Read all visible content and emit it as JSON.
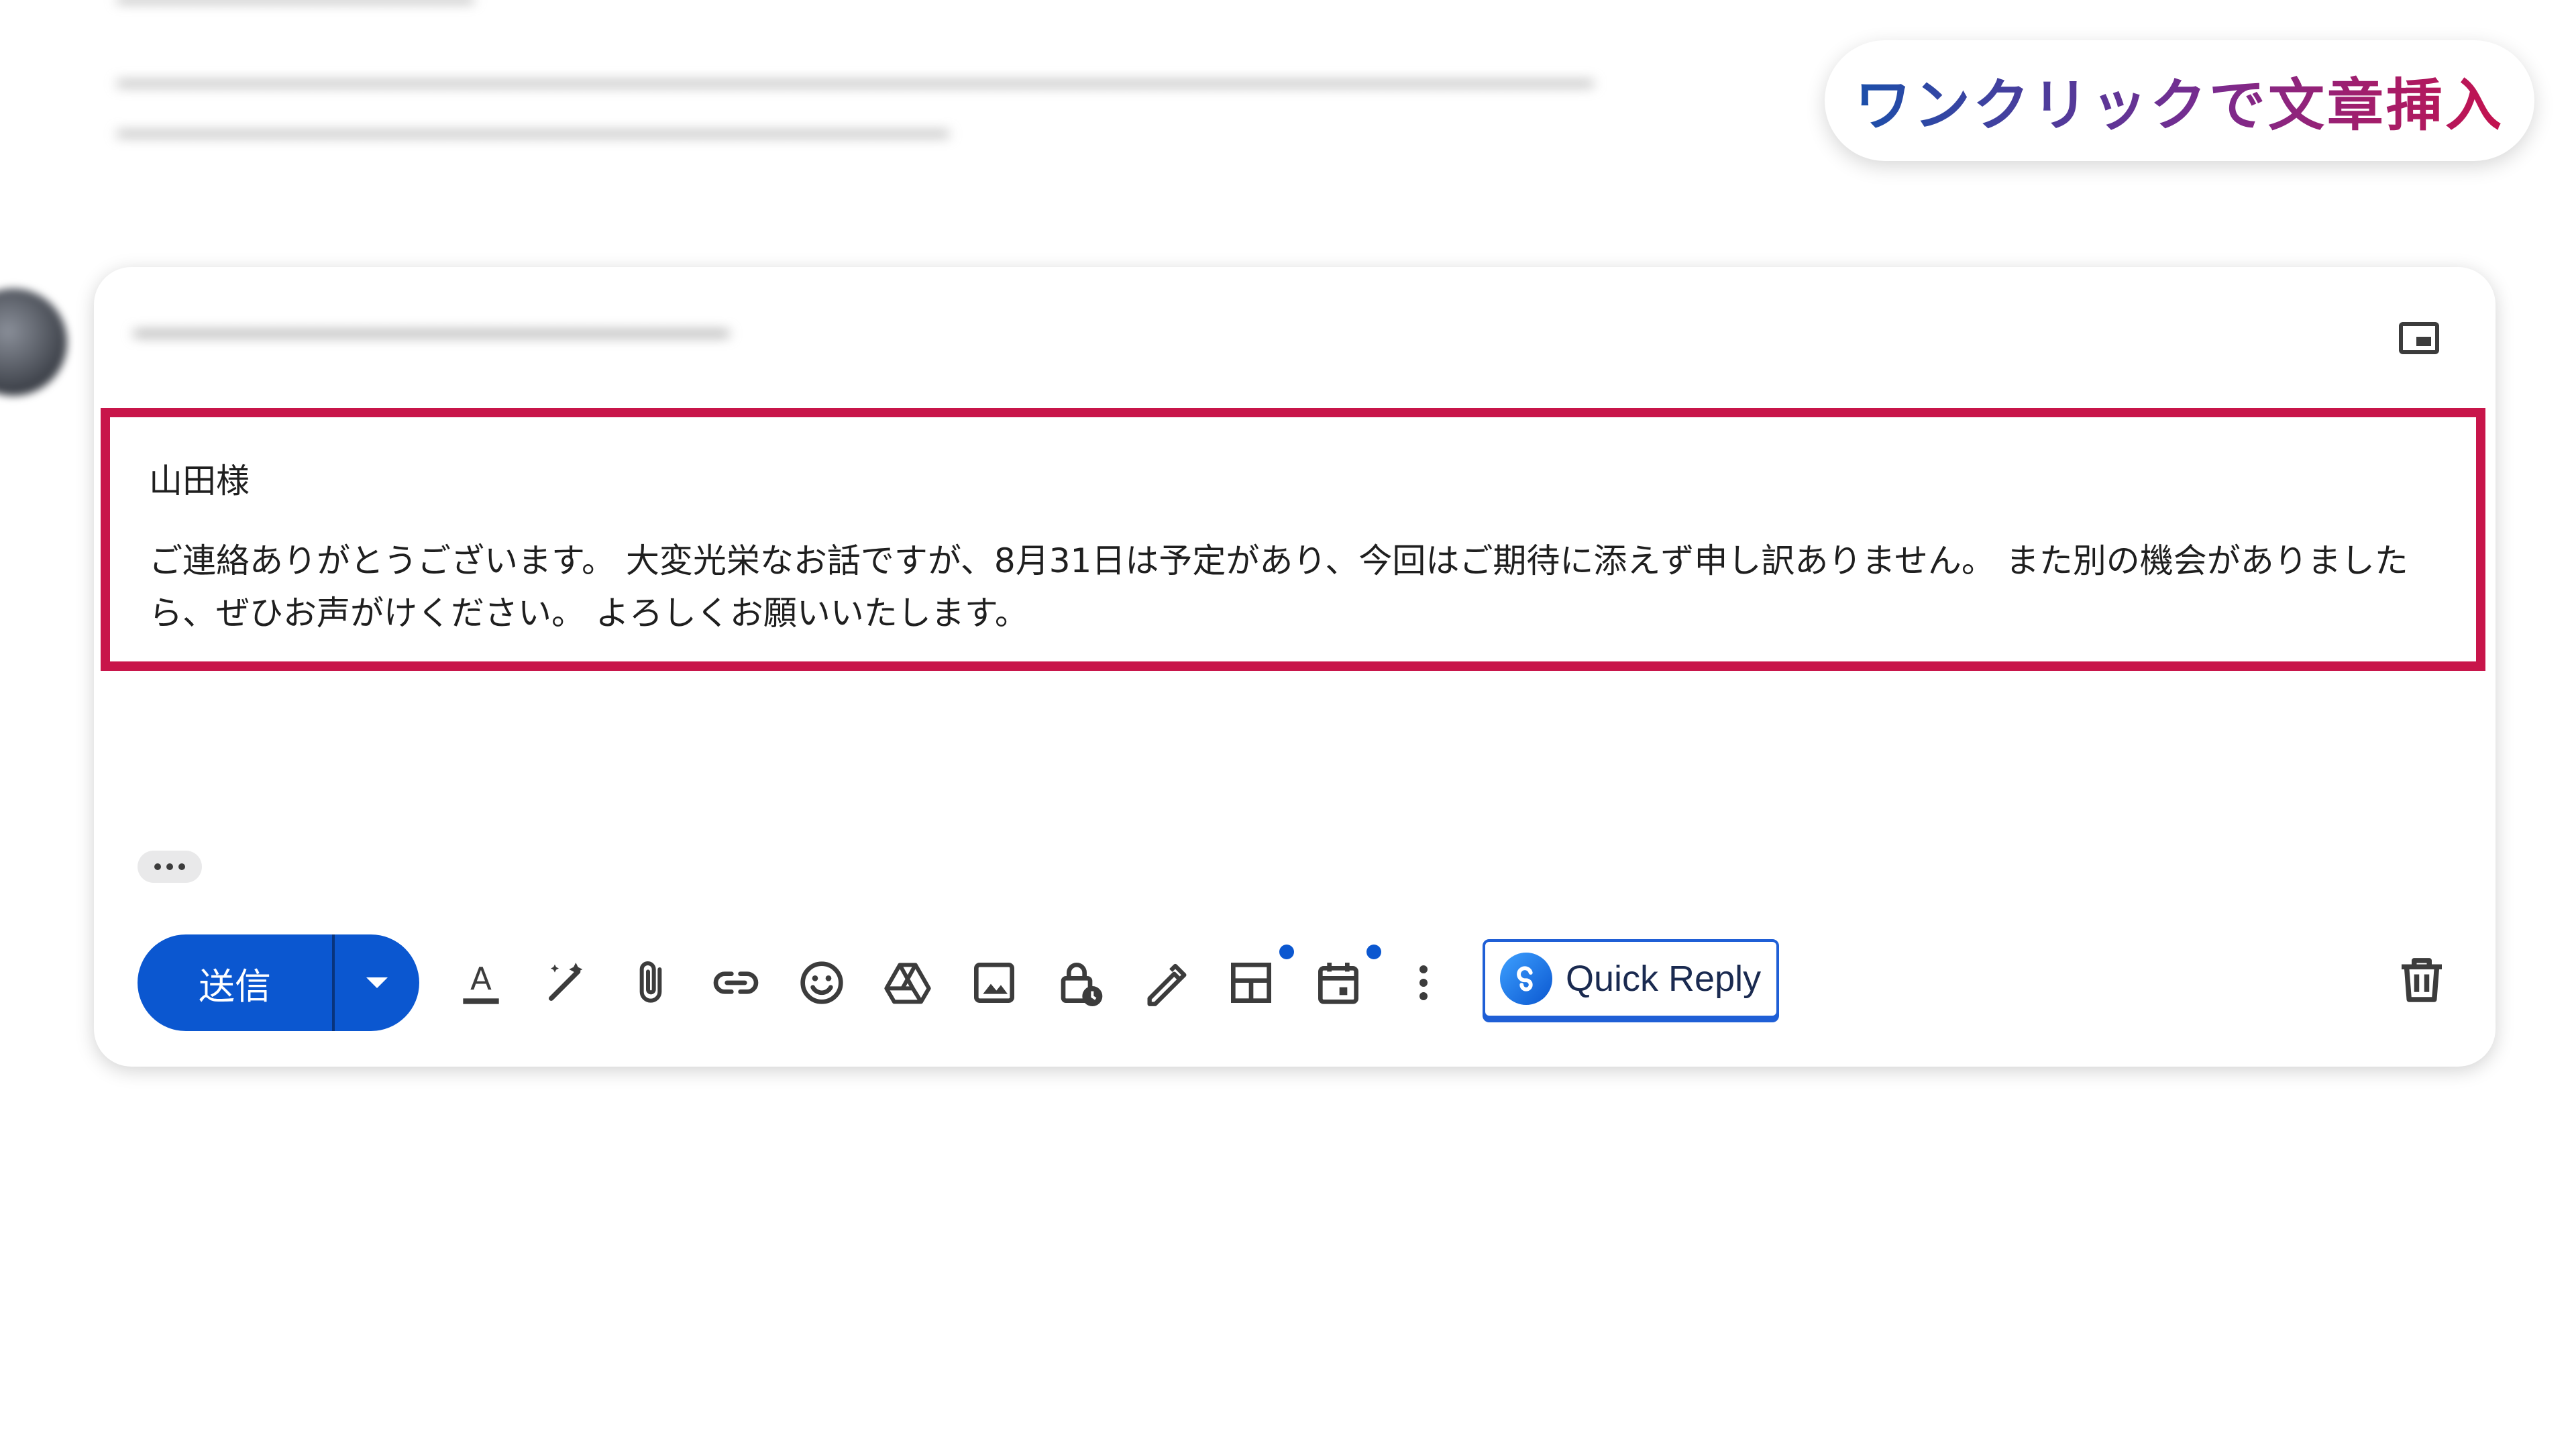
{
  "background": {
    "lines": [
      "━━━━━━━━━━━━━━━━━━━━━",
      "━━━━━━━━━━━━━━━━━━━━━━━━━━━━━━━━━━━━━━━━━━━━━━━━━━━━━━━━━━━━━━━━━━━━━━━━━━━━━━━━━━━━━━━",
      "━━━━━━━━━━━━━━━━━━━━━━━━━━━━━━━━━━━━━━━━━━━━━━━━━"
    ]
  },
  "badge": {
    "text": "ワンクリックで文章挿入"
  },
  "compose": {
    "recipient": "━━━━━━━━━━━━━━━━━━━━━━━━━━━━━━━━",
    "greeting": "山田様",
    "message": "ご連絡ありがとうございます。 大変光栄なお話ですが、8月31日は予定があり、今回はご期待に添えず申し訳ありません。 また別の機会がありましたら、ぜひお声がけください。 よろしくお願いいたします。"
  },
  "toolbar": {
    "send_label": "送信",
    "quick_reply_label": "Quick Reply",
    "icons": [
      "formatting-icon",
      "ai-write-icon",
      "attach-icon",
      "link-icon",
      "emoji-icon",
      "drive-icon",
      "image-icon",
      "confidential-icon",
      "signature-icon",
      "layout-icon",
      "schedule-icon",
      "more-options-icon"
    ]
  },
  "colors": {
    "accent": "#0b57d0",
    "highlight_border": "#c8154a",
    "quick_reply_border": "#1f5fd6"
  }
}
